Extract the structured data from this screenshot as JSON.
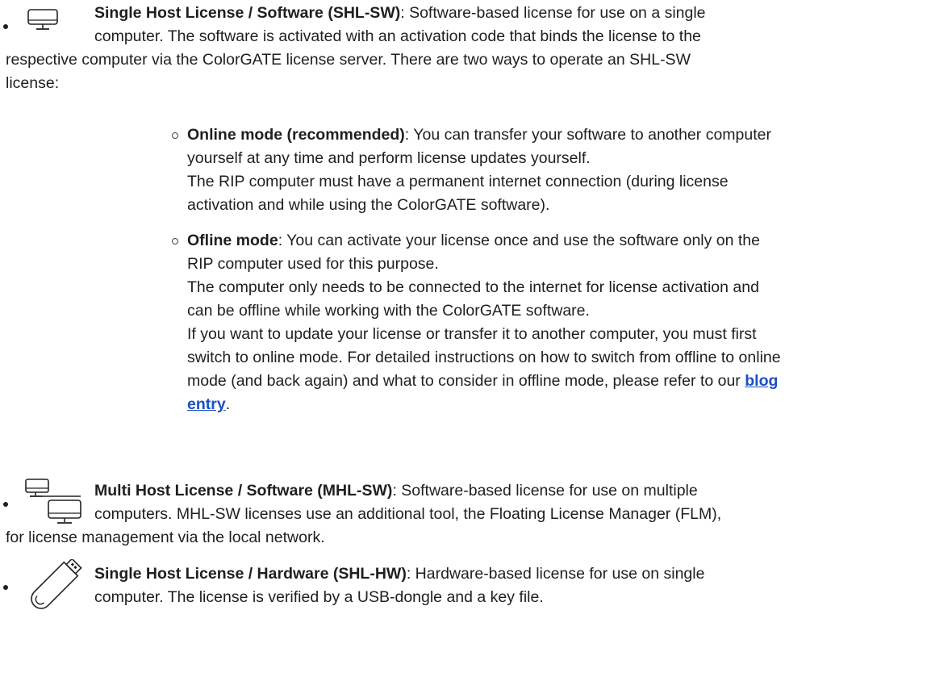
{
  "licenses": [
    {
      "icon": "monitor-icon",
      "title": "Single Host License / Software (SHL-SW)",
      "sep": ": ",
      "line1": "Software-based license for use on a single",
      "line2": "computer. The software is activated with an activation code that binds the license to the",
      "line3": "respective computer via the ColorGATE license server. There are two ways to operate an SHL-SW",
      "line4": "license:"
    },
    {
      "icon": "two-monitors-icon",
      "title": "Multi Host License / Software (MHL-SW)",
      "sep": ": ",
      "line1": "Software-based license for use on multiple",
      "line2": "computers. MHL-SW licenses use an additional tool, the Floating License Manager (FLM),",
      "line3": "for license management via the local network."
    },
    {
      "icon": "usb-dongle-icon",
      "title": "Single Host License / Hardware (SHL-HW)",
      "sep": ": ",
      "line1": "Hardware-based license for use on single",
      "line2": "computer. The license is verified by a USB-dongle and a key file."
    }
  ],
  "modes": [
    {
      "title": "Online mode (recommended)",
      "sep": ": ",
      "lines": [
        "You can transfer your software to another computer",
        "yourself at any time and perform license updates yourself.",
        "The RIP computer must have a permanent internet connection (during license",
        "activation and while using the ColorGATE software)."
      ]
    },
    {
      "title": "Ofline mode",
      "sep": ": ",
      "lines": [
        "You can activate your license once and use the software only on the",
        "RIP computer used for this purpose.",
        "The computer only needs to be connected to the internet for license activation and",
        "can be offline while working with the ColorGATE software.",
        "If you want to update your license or transfer it to another computer, you must first",
        "switch to online mode. For detailed instructions on how to switch from offline to online",
        "mode (and back again) and what to consider in offline mode, please refer to our "
      ],
      "link_part1": "blog",
      "link_part2": "entry",
      "end": "."
    }
  ],
  "colors": {
    "text": "#1f1f1f",
    "link": "#1a4fc4"
  }
}
